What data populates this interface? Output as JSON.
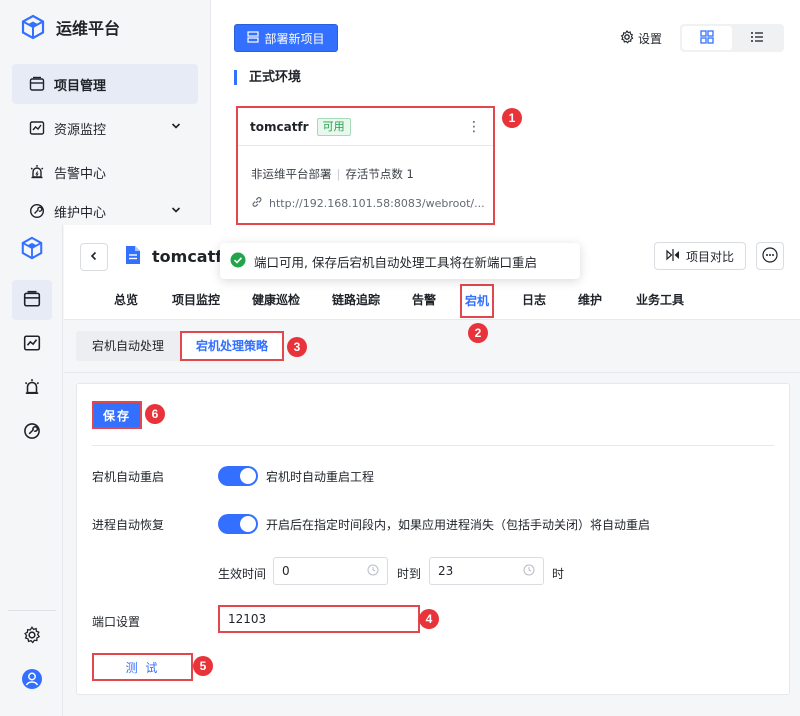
{
  "top": {
    "brand": {
      "name": "运维平台"
    },
    "nav": [
      {
        "label": "项目管理",
        "active": true
      },
      {
        "label": "资源监控",
        "expandable": true
      },
      {
        "label": "告警中心"
      },
      {
        "label": "维护中心",
        "expandable": true
      }
    ],
    "toolbar": {
      "deploy_label": "部署新项目",
      "settings_label": "设置"
    },
    "section_title": "正式环境",
    "project_card": {
      "name": "tomcatfr",
      "status": "可用",
      "deploy_type": "非运维平台部署",
      "nodes": "存活节点数 1",
      "url": "http://192.168.101.58:8083/webroot/..."
    }
  },
  "detail": {
    "title": "tomcatfr",
    "compare_label": "项目对比",
    "tabs": [
      "总览",
      "项目监控",
      "健康巡检",
      "链路追踪",
      "告警",
      "宕机",
      "日志",
      "维护",
      "业务工具"
    ],
    "active_tab": "宕机",
    "subtabs": [
      "宕机自动处理",
      "宕机处理策略"
    ],
    "active_subtab": "宕机处理策略",
    "toast": "端口可用, 保存后宕机自动处理工具将在新端口重启",
    "save_label": "保存",
    "auto_restart": {
      "label": "宕机自动重启",
      "enabled": true,
      "desc": "宕机时自动重启工程"
    },
    "process_recovery": {
      "label": "进程自动恢复",
      "enabled": true,
      "desc": "开启后在指定时间段内，如果应用进程消失（包括手动关闭）将自动重启"
    },
    "effective_time": {
      "label": "生效时间",
      "from": "0",
      "to_label": "时到",
      "to": "23",
      "unit": "时"
    },
    "port": {
      "label": "端口设置",
      "value": "12103"
    },
    "test_label": "测 试"
  },
  "annotations": [
    "1",
    "2",
    "3",
    "4",
    "5",
    "6"
  ],
  "colors": {
    "primary": "#3370ff",
    "highlight": "#e0484e",
    "badge": "#e8333a",
    "success": "#22a44b"
  }
}
